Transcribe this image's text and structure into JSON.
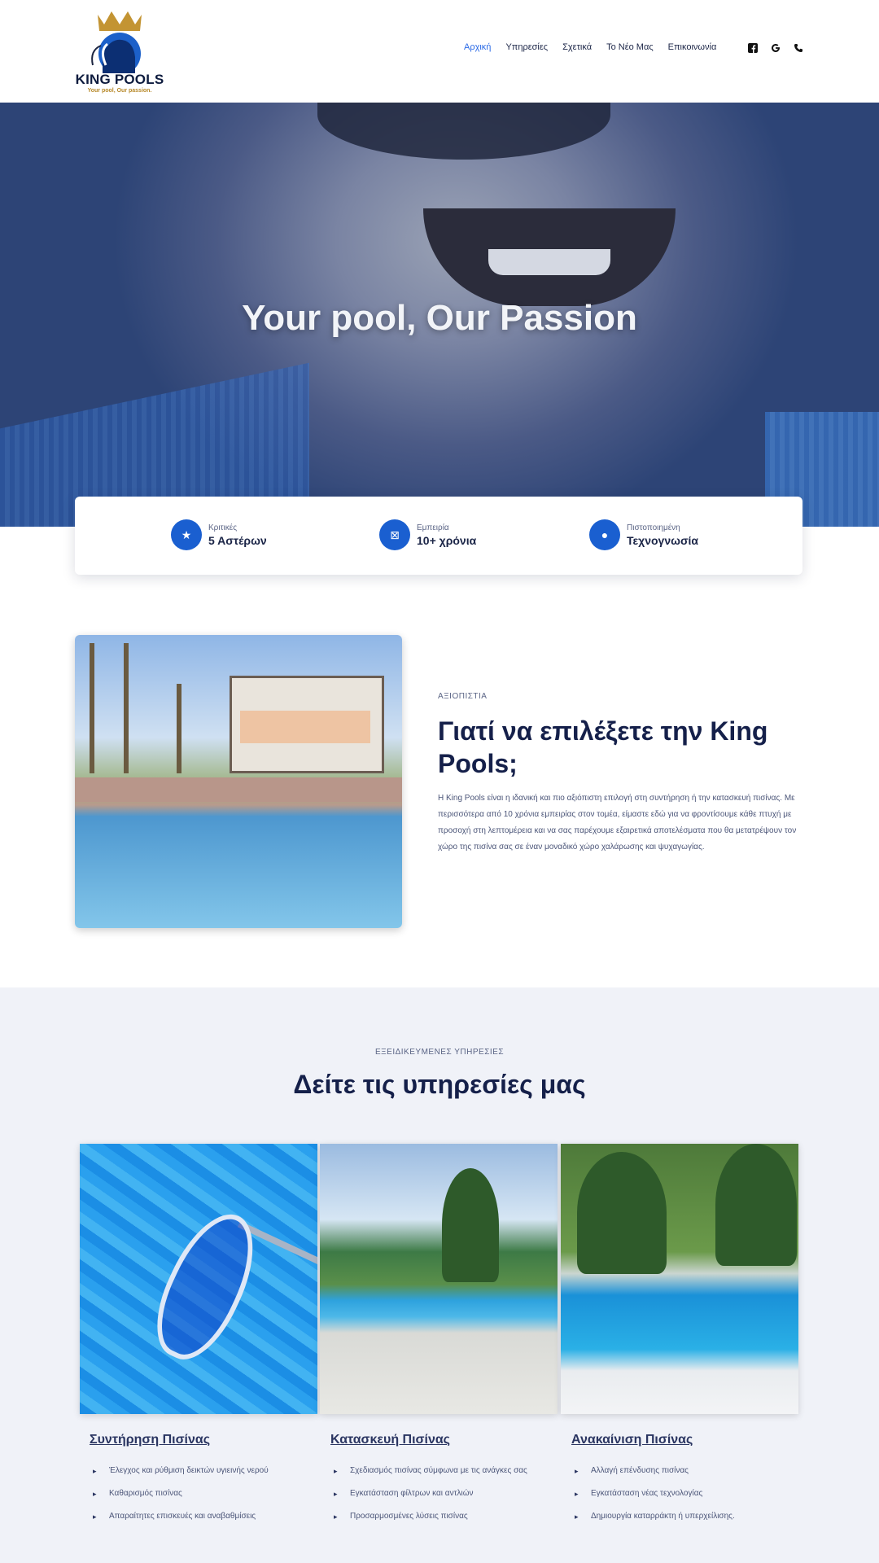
{
  "brand": {
    "name": "KING POOLS",
    "tagline": "Your pool, Our passion."
  },
  "nav": {
    "items": [
      "Αρχική",
      "Υπηρεσίες",
      "Σχετικά",
      "Το Νέο Μας",
      "Επικοινωνία"
    ],
    "active_index": 0
  },
  "social": [
    "facebook-icon",
    "google-icon",
    "phone-icon"
  ],
  "hero": {
    "title": "Your pool, Our Passion"
  },
  "features": [
    {
      "label": "Κριτικές",
      "value": "5 Αστέρων",
      "icon": "star-icon"
    },
    {
      "label": "Εμπειρία",
      "value": "10+ χρόνια",
      "icon": "badge-icon"
    },
    {
      "label": "Πιστοποιημένη",
      "value": "Τεχνογνωσία",
      "icon": "circle-icon"
    }
  ],
  "why": {
    "eyebrow": "ΑΞΙΟΠΙΣΤΙΑ",
    "title": "Γιατί να επιλέξετε την King Pools;",
    "text": "Η King Pools είναι η ιδανική και πιο αξιόπιστη επιλογή στη συντήρηση ή την κατασκευή πισίνας. Με περισσότερα από 10 χρόνια εμπειρίας στον τομέα, είμαστε εδώ για να φροντίσουμε κάθε πτυχή με προσοχή στη λεπτομέρεια και να σας παρέχουμε εξαιρετικά αποτελέσματα που θα μετατρέψουν τον χώρο της πισίνα σας σε έναν μοναδικό χώρο χαλάρωσης και ψυχαγωγίας."
  },
  "services": {
    "eyebrow": "ΕΞΕΙΔΙΚΕΥΜΕΝΕΣ ΥΠΗΡΕΣΙΕΣ",
    "title": "Δείτε τις υπηρεσίες μας",
    "cards": [
      {
        "title": "Συντήρηση Πισίνας",
        "items": [
          "Έλεγχος και ρύθμιση δεικτών υγιεινής νερού",
          "Καθαρισμός πισίνας",
          "Απαραίτητες επισκευές και αναβαθμίσεις"
        ]
      },
      {
        "title": "Κατασκευή Πισίνας",
        "items": [
          "Σχεδιασμός πισίνας σύμφωνα με τις ανάγκες σας",
          "Εγκατάσταση φίλτρων και αντλιών",
          "Προσαρμοσμένες λύσεις πισίνας"
        ]
      },
      {
        "title": "Ανακαίνιση Πισίνας",
        "items": [
          "Αλλαγή επένδυσης πισίνας",
          "Εγκατάσταση νέας τεχνολογίας",
          "Δημιουργία καταρράκτη ή υπερχείλισης."
        ]
      }
    ]
  },
  "colors": {
    "primary": "#1a5fd0",
    "dark": "#15204a",
    "active_nav": "#2b6ae6",
    "gold": "#b7892a"
  }
}
